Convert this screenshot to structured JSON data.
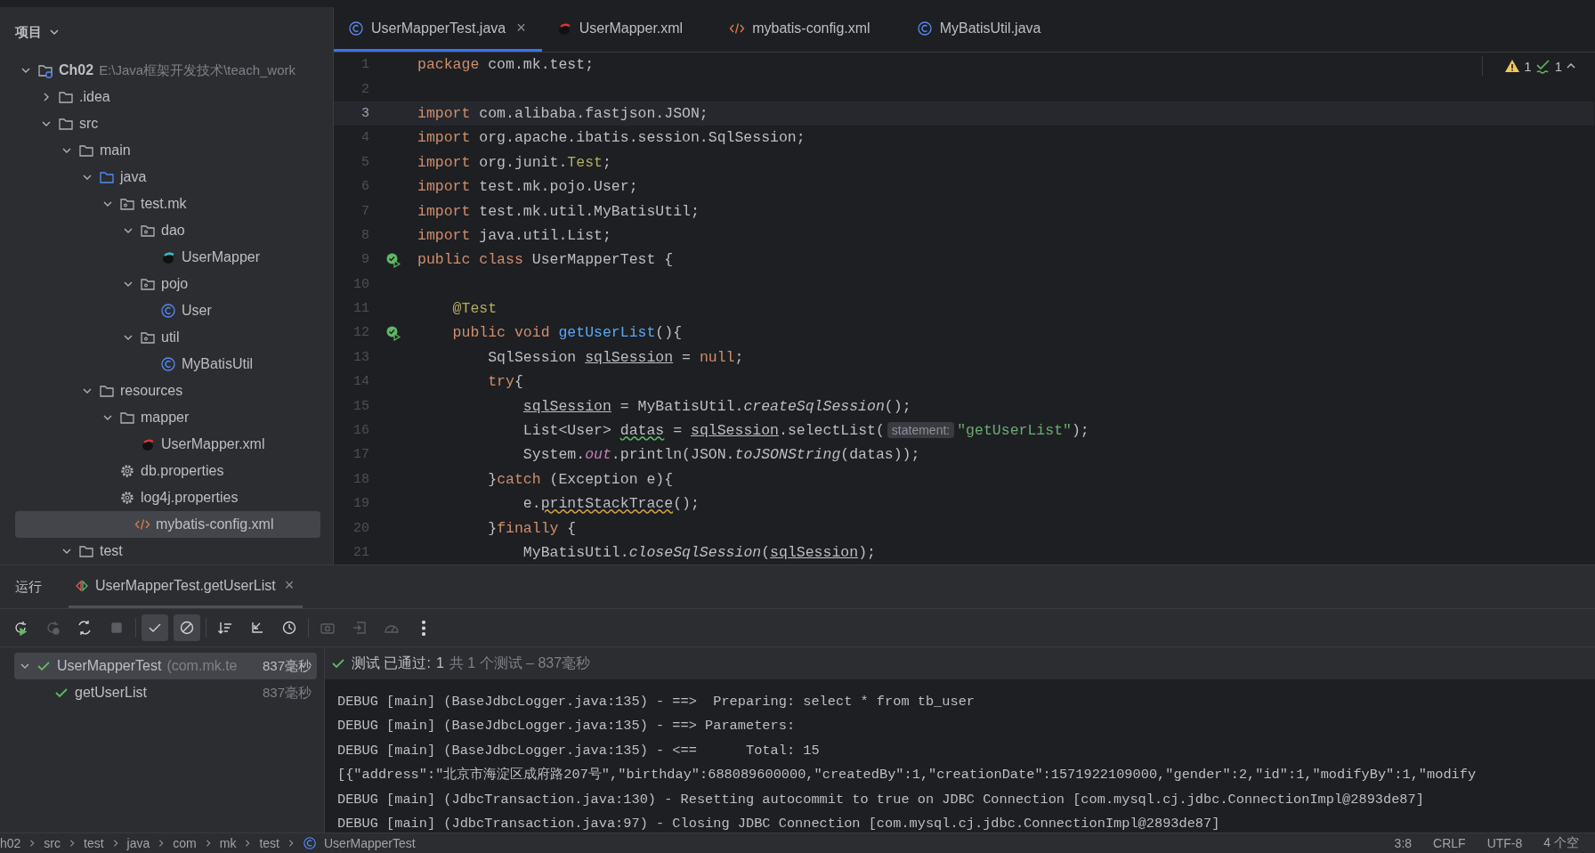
{
  "project": {
    "title": "项目",
    "tree": [
      {
        "name": "Ch02",
        "kind": "module",
        "path": "E:\\Java框架开发技术\\teach_work",
        "expanded": true,
        "selected": false,
        "children": [
          {
            "name": ".idea",
            "kind": "folder",
            "expanded": false,
            "selected": false
          },
          {
            "name": "src",
            "kind": "folder",
            "expanded": true,
            "selected": false,
            "children": [
              {
                "name": "main",
                "kind": "folder",
                "expanded": true,
                "selected": false,
                "children": [
                  {
                    "name": "java",
                    "kind": "source",
                    "expanded": true,
                    "selected": false,
                    "children": [
                      {
                        "name": "test.mk",
                        "kind": "package",
                        "expanded": true,
                        "selected": false,
                        "children": [
                          {
                            "name": "dao",
                            "kind": "package",
                            "expanded": true,
                            "selected": false,
                            "children": [
                              {
                                "name": "UserMapper",
                                "kind": "mybatis",
                                "selected": false
                              }
                            ]
                          },
                          {
                            "name": "pojo",
                            "kind": "package",
                            "expanded": true,
                            "selected": false,
                            "children": [
                              {
                                "name": "User",
                                "kind": "class",
                                "selected": false
                              }
                            ]
                          },
                          {
                            "name": "util",
                            "kind": "package",
                            "expanded": true,
                            "selected": false,
                            "children": [
                              {
                                "name": "MyBatisUtil",
                                "kind": "class",
                                "selected": false
                              }
                            ]
                          }
                        ]
                      }
                    ]
                  },
                  {
                    "name": "resources",
                    "kind": "folder",
                    "expanded": true,
                    "selected": false,
                    "children": [
                      {
                        "name": "mapper",
                        "kind": "folder",
                        "expanded": true,
                        "selected": false,
                        "children": [
                          {
                            "name": "UserMapper.xml",
                            "kind": "mybatis",
                            "selected": false
                          }
                        ]
                      },
                      {
                        "name": "db.properties",
                        "kind": "properties",
                        "selected": false
                      },
                      {
                        "name": "log4j.properties",
                        "kind": "properties",
                        "selected": false
                      },
                      {
                        "name": "mybatis-config.xml",
                        "kind": "xml",
                        "selected": true
                      }
                    ]
                  }
                ]
              },
              {
                "name": "test",
                "kind": "folder",
                "expanded": true,
                "selected": false
              }
            ]
          }
        ]
      }
    ]
  },
  "editor": {
    "tabs": [
      {
        "label": "UserMapperTest.java",
        "kind": "class",
        "selected": true,
        "close": "×"
      },
      {
        "label": "UserMapper.xml",
        "kind": "mybatis",
        "selected": false
      },
      {
        "label": "mybatis-config.xml",
        "kind": "xml",
        "selected": false
      },
      {
        "label": "MyBatisUtil.java",
        "kind": "class",
        "selected": false
      }
    ],
    "inspections": {
      "warnings": "1",
      "typos": "1"
    },
    "lines": [
      {
        "number": "1",
        "current": false,
        "tokens": [
          {
            "kind": "keyword",
            "text": "package "
          },
          {
            "kind": "plain",
            "text": "com.mk.test;"
          }
        ]
      },
      {
        "number": "2",
        "current": false
      },
      {
        "number": "3",
        "current": true,
        "tokens": [
          {
            "kind": "keyword",
            "text": "import "
          },
          {
            "kind": "plain",
            "text": "com.alibaba.fastjson.JSON;"
          }
        ]
      },
      {
        "number": "4",
        "current": false,
        "tokens": [
          {
            "kind": "keyword",
            "text": "import "
          },
          {
            "kind": "plain",
            "text": "org.apache.ibatis.session.SqlSession;"
          }
        ]
      },
      {
        "number": "5",
        "current": false,
        "tokens": [
          {
            "kind": "keyword",
            "text": "import "
          },
          {
            "kind": "plain",
            "text": "org.junit."
          },
          {
            "kind": "annotation",
            "text": "Test"
          },
          {
            "kind": "plain",
            "text": ";"
          }
        ]
      },
      {
        "number": "6",
        "current": false,
        "tokens": [
          {
            "kind": "keyword",
            "text": "import "
          },
          {
            "kind": "plain",
            "text": "test.mk.pojo.User;"
          }
        ]
      },
      {
        "number": "7",
        "current": false,
        "tokens": [
          {
            "kind": "keyword",
            "text": "import "
          },
          {
            "kind": "plain",
            "text": "test.mk.util.MyBatisUtil;"
          }
        ]
      },
      {
        "number": "8",
        "current": false,
        "tokens": [
          {
            "kind": "keyword",
            "text": "import "
          },
          {
            "kind": "plain",
            "text": "java.util.List;"
          }
        ]
      },
      {
        "number": "9",
        "current": false,
        "run_marker": true,
        "tokens": [
          {
            "kind": "keyword",
            "text": "public class "
          },
          {
            "kind": "plain",
            "text": "UserMapperTest {"
          }
        ]
      },
      {
        "number": "10",
        "current": false
      },
      {
        "number": "11",
        "current": false,
        "tokens": [
          {
            "kind": "annotation",
            "text": "    @Test"
          }
        ]
      },
      {
        "number": "12",
        "current": false,
        "run_marker": true,
        "tokens": [
          {
            "kind": "keyword",
            "text": "    public void "
          },
          {
            "kind": "method",
            "text": "getUserList"
          },
          {
            "kind": "plain",
            "text": "(){"
          }
        ]
      },
      {
        "number": "13",
        "current": false,
        "tokens": [
          {
            "kind": "plain",
            "text": "        SqlSession "
          },
          {
            "kind": "variable",
            "text": "sqlSession"
          },
          {
            "kind": "plain",
            "text": " = "
          },
          {
            "kind": "keyword",
            "text": "null"
          },
          {
            "kind": "plain",
            "text": ";"
          }
        ]
      },
      {
        "number": "14",
        "current": false,
        "tokens": [
          {
            "kind": "keyword",
            "text": "        try"
          },
          {
            "kind": "plain",
            "text": "{"
          }
        ]
      },
      {
        "number": "15",
        "current": false,
        "tokens": [
          {
            "kind": "variable",
            "text": "            sqlSession"
          },
          {
            "kind": "plain",
            "text": " = MyBatisUtil."
          },
          {
            "kind": "static",
            "text": "createSqlSession"
          },
          {
            "kind": "plain",
            "text": "();"
          }
        ]
      },
      {
        "number": "16",
        "current": false,
        "tokens": [
          {
            "kind": "plain",
            "text": "            List<User> "
          },
          {
            "kind": "unused",
            "text": "datas"
          },
          {
            "kind": "plain",
            "text": " = "
          },
          {
            "kind": "variable",
            "text": "sqlSession"
          },
          {
            "kind": "plain",
            "text": ".selectList("
          },
          {
            "kind": "hint",
            "text": "statement:"
          },
          {
            "kind": "string",
            "text": "\"getUserList\""
          },
          {
            "kind": "plain",
            "text": ");"
          }
        ]
      },
      {
        "number": "17",
        "current": false,
        "tokens": [
          {
            "kind": "plain",
            "text": "            System."
          },
          {
            "kind": "field",
            "text": "out"
          },
          {
            "kind": "plain",
            "text": ".println(JSON."
          },
          {
            "kind": "static",
            "text": "toJSONString"
          },
          {
            "kind": "plain",
            "text": "(datas));"
          }
        ]
      },
      {
        "number": "18",
        "current": false,
        "tokens": [
          {
            "kind": "plain",
            "text": "        }"
          },
          {
            "kind": "keyword",
            "text": "catch"
          },
          {
            "kind": "plain",
            "text": " (Exception e){"
          }
        ]
      },
      {
        "number": "19",
        "current": false,
        "tokens": [
          {
            "kind": "plain",
            "text": "            e."
          },
          {
            "kind": "warning",
            "text": "printStackTrace"
          },
          {
            "kind": "plain",
            "text": "();"
          }
        ]
      },
      {
        "number": "20",
        "current": false,
        "tokens": [
          {
            "kind": "plain",
            "text": "        }"
          },
          {
            "kind": "keyword",
            "text": "finally"
          },
          {
            "kind": "plain",
            "text": " {"
          }
        ]
      },
      {
        "number": "21",
        "current": false,
        "tokens": [
          {
            "kind": "plain",
            "text": "            MyBatisUtil."
          },
          {
            "kind": "static",
            "text": "closeSqlSession"
          },
          {
            "kind": "plain",
            "text": "("
          },
          {
            "kind": "variable",
            "text": "sqlSession"
          },
          {
            "kind": "plain",
            "text": ");"
          }
        ]
      }
    ]
  },
  "run_panel": {
    "title": "运行",
    "tabs": [
      {
        "label": "UserMapperTest.getUserList",
        "selected": true,
        "close": "×"
      }
    ],
    "toolbar": [
      [
        {
          "kind": "rerun",
          "disabled": false,
          "on": false
        },
        {
          "kind": "rerun_failed",
          "disabled": true,
          "on": false
        },
        {
          "kind": "auto_rerun",
          "disabled": false,
          "on": false
        },
        {
          "kind": "stop",
          "disabled": true,
          "on": false
        }
      ],
      [
        {
          "kind": "show_passed",
          "disabled": false,
          "on": true
        },
        {
          "kind": "show_ignored",
          "disabled": false,
          "on": true
        }
      ],
      [
        {
          "kind": "sort",
          "disabled": false,
          "on": false
        },
        {
          "kind": "collapse",
          "disabled": false,
          "on": false
        },
        {
          "kind": "history",
          "disabled": false,
          "on": false
        }
      ],
      [
        {
          "kind": "screenshot",
          "disabled": true,
          "on": false
        },
        {
          "kind": "export",
          "disabled": true,
          "on": false
        },
        {
          "kind": "gauge",
          "disabled": true,
          "on": false
        },
        {
          "kind": "more",
          "disabled": false,
          "on": false
        }
      ]
    ],
    "tests": [
      {
        "name": "UserMapperTest",
        "package": "(com.mk.te",
        "time": "837毫秒",
        "passed": true,
        "expanded": true,
        "selected": true,
        "children": [
          {
            "name": "getUserList",
            "time": "837毫秒",
            "passed": true,
            "selected": false
          }
        ]
      }
    ],
    "summary": {
      "label": "测试 已通过:",
      "count": "1",
      "detail": "共 1 个测试 – 837毫秒"
    },
    "console": [
      "DEBUG [main] (BaseJdbcLogger.java:135) - ==>  Preparing: select * from tb_user",
      "DEBUG [main] (BaseJdbcLogger.java:135) - ==> Parameters: ",
      "DEBUG [main] (BaseJdbcLogger.java:135) - <==      Total: 15",
      "[{\"address\":\"北京市海淀区成府路207号\",\"birthday\":688089600000,\"createdBy\":1,\"creationDate\":1571922109000,\"gender\":2,\"id\":1,\"modifyBy\":1,\"modify",
      "DEBUG [main] (JdbcTransaction.java:130) - Resetting autocommit to true on JDBC Connection [com.mysql.cj.jdbc.ConnectionImpl@2893de87]",
      "DEBUG [main] (JdbcTransaction.java:97) - Closing JDBC Connection [com.mysql.cj.jdbc.ConnectionImpl@2893de87]"
    ]
  },
  "status_bar": {
    "breadcrumbs": [
      {
        "label": "h02",
        "kind": "folder"
      },
      {
        "label": "src",
        "kind": "folder"
      },
      {
        "label": "test",
        "kind": "folder"
      },
      {
        "label": "java",
        "kind": "folder"
      },
      {
        "label": "com",
        "kind": "folder"
      },
      {
        "label": "mk",
        "kind": "folder"
      },
      {
        "label": "test",
        "kind": "folder"
      },
      {
        "label": "UserMapperTest",
        "kind": "class"
      }
    ],
    "items": [
      "3:8",
      "CRLF",
      "UTF-8",
      "4 个空"
    ]
  }
}
